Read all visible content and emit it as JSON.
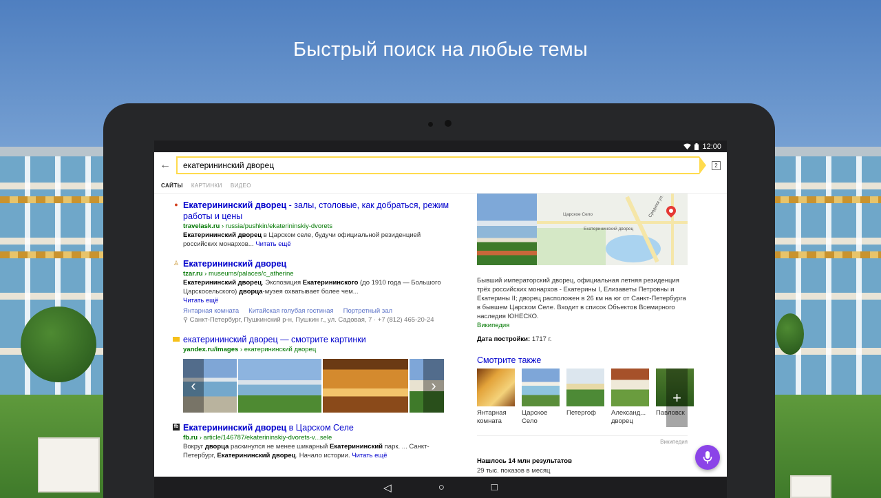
{
  "headline": "Быстрый поиск на любые темы",
  "status_bar": {
    "time": "12:00",
    "wifi_icon": "wifi-icon",
    "battery_icon": "battery-icon"
  },
  "search": {
    "query": "екатерининский дворец",
    "tab_count": "2"
  },
  "tabs": [
    {
      "label": "САЙТЫ",
      "active": true
    },
    {
      "label": "КАРТИНКИ",
      "active": false
    },
    {
      "label": "ВИДЕО",
      "active": false
    }
  ],
  "results": {
    "r1": {
      "title_bold": "Екатерининский дворец",
      "title_rest": " - залы, столовые, как добраться, режим работы и цены",
      "url_host": "travelask.ru",
      "url_path": " › russia/pushkin/ekaterininskiy-dvorets",
      "snippet_bold": "Екатерининский дворец",
      "snippet_rest": " в Царском селе, будучи официальной резиденцией российских монархов...",
      "more": "Читать ещё"
    },
    "r2": {
      "title": "Екатерининский дворец",
      "url_host": "tzar.ru",
      "url_path": " › museums/palaces/c_atherine",
      "snippet_b1": "Екатерининский дворец",
      "snippet_t1": ". Экспозиция ",
      "snippet_b2": "Екатерининского",
      "snippet_t2": " (до 1910 года — Большого Царскосельского) ",
      "snippet_b3": "дворца",
      "snippet_t3": "-музея охватывает более чем...",
      "more": "Читать ещё",
      "sitelinks": [
        "Янтарная комната",
        "Китайская голубая гостиная",
        "Портретный зал"
      ],
      "address": "Санкт-Петербург, Пушкинский р-н, Пушкин г., ул. Садовая, 7",
      "phone": "+7 (812) 465-20-24"
    },
    "r3": {
      "title_bold": "екатерининский дворец",
      "title_rest": " — смотрите картинки",
      "url_host": "yandex.ru/images",
      "url_path": " › екатерининский дворец"
    },
    "r4": {
      "title_bold": "Екатерининский дворец",
      "title_rest": " в Царском Селе",
      "url_host": "fb.ru",
      "url_path": " › article/146787/ekaterininskiy-dvorets-v...sele",
      "s1": "Вокруг ",
      "b1": "дворца",
      "s2": " раскинулся не менее шикарный ",
      "b2": "Екатерининский",
      "s3": " парк. ... Санкт-Петербург, ",
      "b3": "Екатерининский дворец",
      "s4": ". Начало истории. ",
      "more": "Читать ещё"
    }
  },
  "knowledge": {
    "map_labels": {
      "city": "Царское Село",
      "place": "Екатерининский дворец",
      "street": "Средняя ул."
    },
    "description": "Бывший императорский дворец, официальная летняя резиденция трёх российских монархов - Екатерины I, Елизаветы Петровны и Екатерины II; дворец расположен в 26 км на юг от Санкт-Петербурга в бывшем Царском Селе. Входит в список Объектов Всемирного наследия ЮНЕСКО.",
    "source": "Википедия",
    "fact_label": "Дата постройки:",
    "fact_value": " 1717 г.",
    "see_also_title": "Смотрите также",
    "see_also": [
      {
        "label": "Янтарная комната"
      },
      {
        "label": "Царское Село"
      },
      {
        "label": "Петергоф"
      },
      {
        "label": "Александ... дворец"
      },
      {
        "label": "Павловск"
      }
    ],
    "wiki_small": "Википедия",
    "stats_title": "Нашлось 14 млн результатов",
    "stats_sub": "29 тыс. показов в месяц"
  },
  "colors": {
    "search_accent": "#ffdb4d",
    "link": "#0000cc",
    "url_green": "#007700",
    "mic": "#8b44e8"
  }
}
